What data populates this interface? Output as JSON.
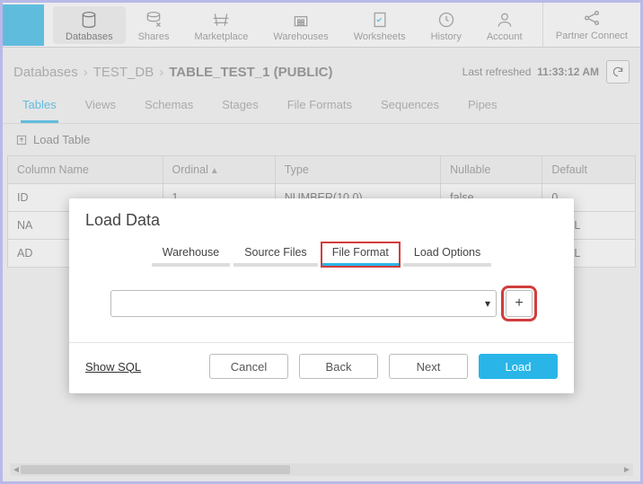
{
  "topnav": {
    "items": [
      {
        "label": "Databases"
      },
      {
        "label": "Shares"
      },
      {
        "label": "Marketplace"
      },
      {
        "label": "Warehouses"
      },
      {
        "label": "Worksheets"
      },
      {
        "label": "History"
      },
      {
        "label": "Account"
      }
    ],
    "partner_label": "Partner Connect"
  },
  "breadcrumb": {
    "root": "Databases",
    "db": "TEST_DB",
    "table": "TABLE_TEST_1 (PUBLIC)",
    "last_refreshed_label": "Last refreshed",
    "last_refreshed_time": "11:33:12 AM"
  },
  "subtabs": [
    "Tables",
    "Views",
    "Schemas",
    "Stages",
    "File Formats",
    "Sequences",
    "Pipes"
  ],
  "loadtable_label": "Load Table",
  "table": {
    "headers": [
      "Column Name",
      "Ordinal",
      "Type",
      "Nullable",
      "Default"
    ],
    "rows": [
      {
        "col": "ID",
        "ord": "1",
        "type": "NUMBER(10,0)",
        "nullable": "false",
        "default": "0"
      },
      {
        "col": "NA",
        "ord": "",
        "type": "",
        "nullable": "",
        "default": "NULL"
      },
      {
        "col": "AD",
        "ord": "",
        "type": "",
        "nullable": "",
        "default": "NULL"
      }
    ]
  },
  "modal": {
    "title": "Load Data",
    "steps": [
      "Warehouse",
      "Source Files",
      "File Format",
      "Load Options"
    ],
    "show_sql": "Show SQL",
    "cancel": "Cancel",
    "back": "Back",
    "next": "Next",
    "load": "Load"
  }
}
